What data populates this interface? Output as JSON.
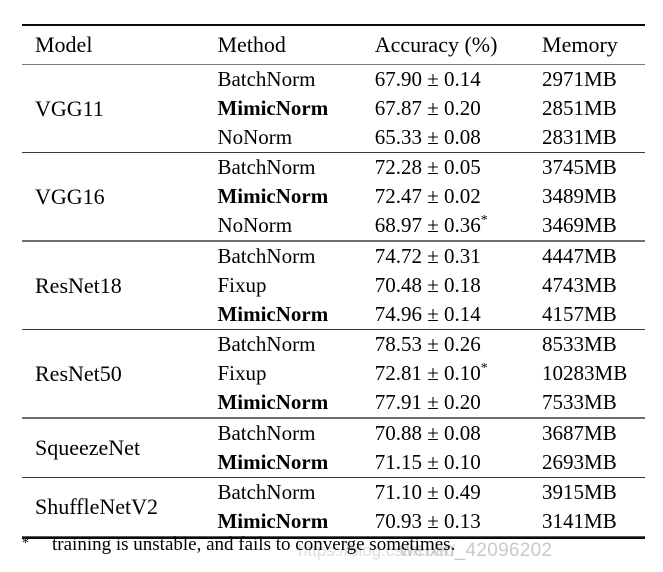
{
  "table": {
    "columns": [
      "Model",
      "Method",
      "Accuracy (%)",
      "Memory"
    ],
    "groups": [
      {
        "model": "VGG11",
        "rows": [
          {
            "method": "BatchNorm",
            "bold": false,
            "accuracy": "67.90 ± 0.14",
            "star": false,
            "memory": "2971MB"
          },
          {
            "method": "MimicNorm",
            "bold": true,
            "accuracy": "67.87 ± 0.20",
            "star": false,
            "memory": "2851MB"
          },
          {
            "method": "NoNorm",
            "bold": false,
            "accuracy": "65.33 ± 0.08",
            "star": false,
            "memory": "2831MB"
          }
        ],
        "separator_after": "single"
      },
      {
        "model": "VGG16",
        "rows": [
          {
            "method": "BatchNorm",
            "bold": false,
            "accuracy": "72.28 ± 0.05",
            "star": false,
            "memory": "3745MB"
          },
          {
            "method": "MimicNorm",
            "bold": true,
            "accuracy": "72.47 ± 0.02",
            "star": false,
            "memory": "3489MB"
          },
          {
            "method": "NoNorm",
            "bold": false,
            "accuracy": "68.97 ± 0.36",
            "star": true,
            "memory": "3469MB"
          }
        ],
        "separator_after": "double"
      },
      {
        "model": "ResNet18",
        "rows": [
          {
            "method": "BatchNorm",
            "bold": false,
            "accuracy": "74.72 ± 0.31",
            "star": false,
            "memory": "4447MB"
          },
          {
            "method": "Fixup",
            "bold": false,
            "accuracy": "70.48 ± 0.18",
            "star": false,
            "memory": "4743MB"
          },
          {
            "method": "MimicNorm",
            "bold": true,
            "accuracy": "74.96 ± 0.14",
            "star": false,
            "memory": "4157MB"
          }
        ],
        "separator_after": "single"
      },
      {
        "model": "ResNet50",
        "rows": [
          {
            "method": "BatchNorm",
            "bold": false,
            "accuracy": "78.53 ± 0.26",
            "star": false,
            "memory": "8533MB"
          },
          {
            "method": "Fixup",
            "bold": false,
            "accuracy": "72.81 ± 0.10",
            "star": true,
            "memory": "10283MB"
          },
          {
            "method": "MimicNorm",
            "bold": true,
            "accuracy": "77.91 ± 0.20",
            "star": false,
            "memory": "7533MB"
          }
        ],
        "separator_after": "double"
      },
      {
        "model": "SqueezeNet",
        "rows": [
          {
            "method": "BatchNorm",
            "bold": false,
            "accuracy": "70.88 ± 0.08",
            "star": false,
            "memory": "3687MB"
          },
          {
            "method": "MimicNorm",
            "bold": true,
            "accuracy": "71.15 ± 0.10",
            "star": false,
            "memory": "2693MB"
          }
        ],
        "separator_after": "single"
      },
      {
        "model": "ShuffleNetV2",
        "rows": [
          {
            "method": "BatchNorm",
            "bold": false,
            "accuracy": "71.10 ± 0.49",
            "star": false,
            "memory": "3915MB"
          },
          {
            "method": "MimicNorm",
            "bold": true,
            "accuracy": "70.93 ± 0.13",
            "star": false,
            "memory": "3141MB"
          }
        ],
        "separator_after": "bottom"
      }
    ]
  },
  "footnote": {
    "marker": "*",
    "text": "training is unstable, and fails to converge sometimes."
  },
  "watermark": {
    "text": "weixin_42096202",
    "url_fragment": "https://blog.csdn.net/",
    "color": "#c9c9c9"
  }
}
